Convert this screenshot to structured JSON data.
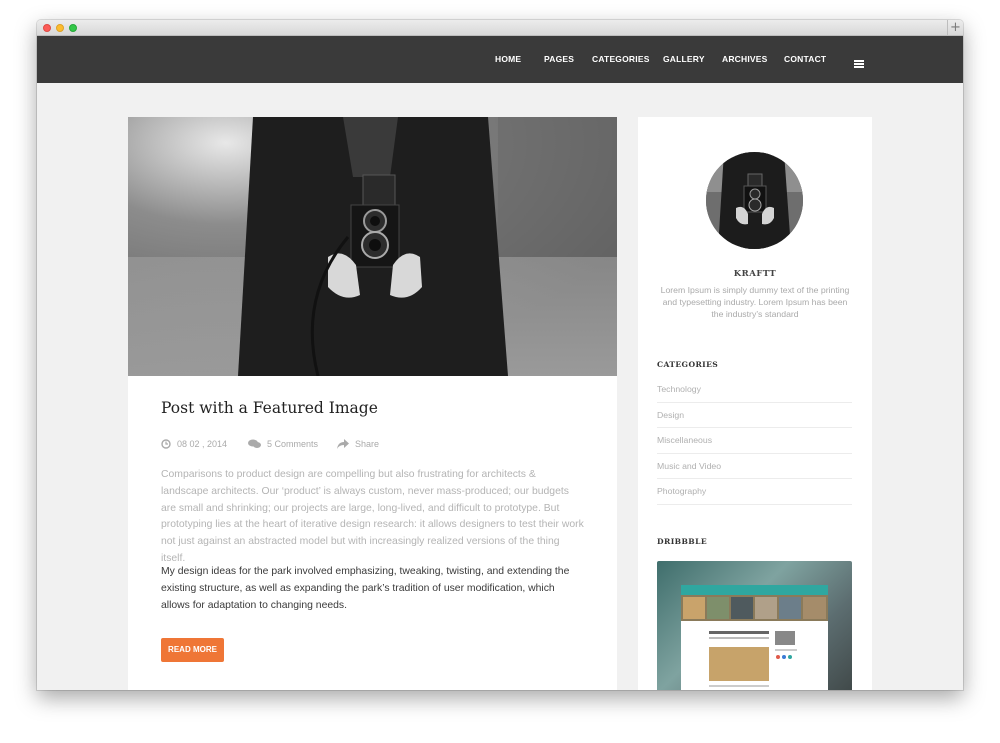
{
  "nav": {
    "items": [
      {
        "label": "HOME"
      },
      {
        "label": "PAGES"
      },
      {
        "label": "CATEGORIES"
      },
      {
        "label": "GALLERY"
      },
      {
        "label": "ARCHIVES"
      },
      {
        "label": "CONTACT"
      }
    ],
    "menu_icon": "hamburger-icon"
  },
  "post": {
    "title": "Post with a Featured Image",
    "date": "08 02 , 2014",
    "comments": "5 Comments",
    "share": "Share",
    "excerpt": "Comparisons to product design are compelling but also frustrating for architects & landscape architects. Our ‘product’ is always custom, never mass-produced; our budgets are small and shrinking; our projects are large, long-lived, and difficult to prototype. But prototyping lies at the heart of iterative design research: it allows designers to test their work not just against an abstracted model but with increasingly realized versions of the thing itself.",
    "body": "My design ideas for the park involved emphasizing, tweaking, twisting, and extending the existing structure, as well as expanding the park’s tradition of user modification, which allows for adaptation to changing needs.",
    "read_more": "READ MORE"
  },
  "sidebar": {
    "author_name": "KRAFTT",
    "author_bio": "Lorem Ipsum is simply dummy text of the printing and typesetting industry. Lorem Ipsum has been the industry’s standard",
    "categories_title": "CATEGORIES",
    "categories": [
      {
        "label": "Technology"
      },
      {
        "label": "Design"
      },
      {
        "label": "Miscellaneous"
      },
      {
        "label": "Music and Video"
      },
      {
        "label": "Photography"
      }
    ],
    "dribbble_title": "DRIBBBLE"
  },
  "colors": {
    "nav_bg": "#3a3a3a",
    "accent": "#ef7636",
    "page_bg": "#f1f1f1"
  }
}
